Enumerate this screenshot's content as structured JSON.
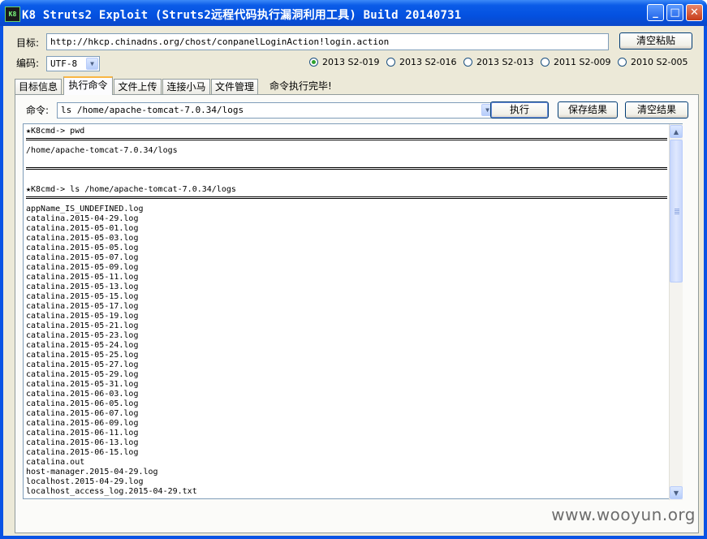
{
  "window": {
    "app_icon_text": "K8",
    "title": "K8 Struts2 Exploit (Struts2远程代码执行漏洞利用工具)  Build 20140731",
    "minimize": "_",
    "maximize": "□",
    "close": "✕"
  },
  "target": {
    "label": "目标:",
    "url": "http://hkcp.chinadns.org/chost/conpanelLoginAction!login.action",
    "clear_paste": "清空粘贴"
  },
  "encoding": {
    "label": "编码:",
    "value": "UTF-8"
  },
  "exploits": [
    {
      "label": "2013 S2-019",
      "selected": true
    },
    {
      "label": "2013 S2-016",
      "selected": false
    },
    {
      "label": "2013 S2-013",
      "selected": false
    },
    {
      "label": "2011 S2-009",
      "selected": false
    },
    {
      "label": "2010 S2-005",
      "selected": false
    }
  ],
  "tabs": [
    {
      "label": "目标信息",
      "active": false
    },
    {
      "label": "执行命令",
      "active": true
    },
    {
      "label": "文件上传",
      "active": false
    },
    {
      "label": "连接小马",
      "active": false
    },
    {
      "label": "文件管理",
      "active": false
    }
  ],
  "status_text": "命令执行完毕!",
  "command": {
    "label": "命令:",
    "value": "ls /home/apache-tomcat-7.0.34/logs",
    "execute": "执行",
    "save": "保存结果",
    "clear": "清空结果"
  },
  "output": {
    "prompt1": "★K8cmd-> pwd",
    "result1": "/home/apache-tomcat-7.0.34/logs",
    "prompt2": "★K8cmd-> ls /home/apache-tomcat-7.0.34/logs",
    "files": [
      "appName_IS_UNDEFINED.log",
      "catalina.2015-04-29.log",
      "catalina.2015-05-01.log",
      "catalina.2015-05-03.log",
      "catalina.2015-05-05.log",
      "catalina.2015-05-07.log",
      "catalina.2015-05-09.log",
      "catalina.2015-05-11.log",
      "catalina.2015-05-13.log",
      "catalina.2015-05-15.log",
      "catalina.2015-05-17.log",
      "catalina.2015-05-19.log",
      "catalina.2015-05-21.log",
      "catalina.2015-05-23.log",
      "catalina.2015-05-24.log",
      "catalina.2015-05-25.log",
      "catalina.2015-05-27.log",
      "catalina.2015-05-29.log",
      "catalina.2015-05-31.log",
      "catalina.2015-06-03.log",
      "catalina.2015-06-05.log",
      "catalina.2015-06-07.log",
      "catalina.2015-06-09.log",
      "catalina.2015-06-11.log",
      "catalina.2015-06-13.log",
      "catalina.2015-06-15.log",
      "catalina.out",
      "host-manager.2015-04-29.log",
      "localhost.2015-04-29.log",
      "localhost_access_log.2015-04-29.txt"
    ]
  },
  "watermark": "www.wooyun.org"
}
